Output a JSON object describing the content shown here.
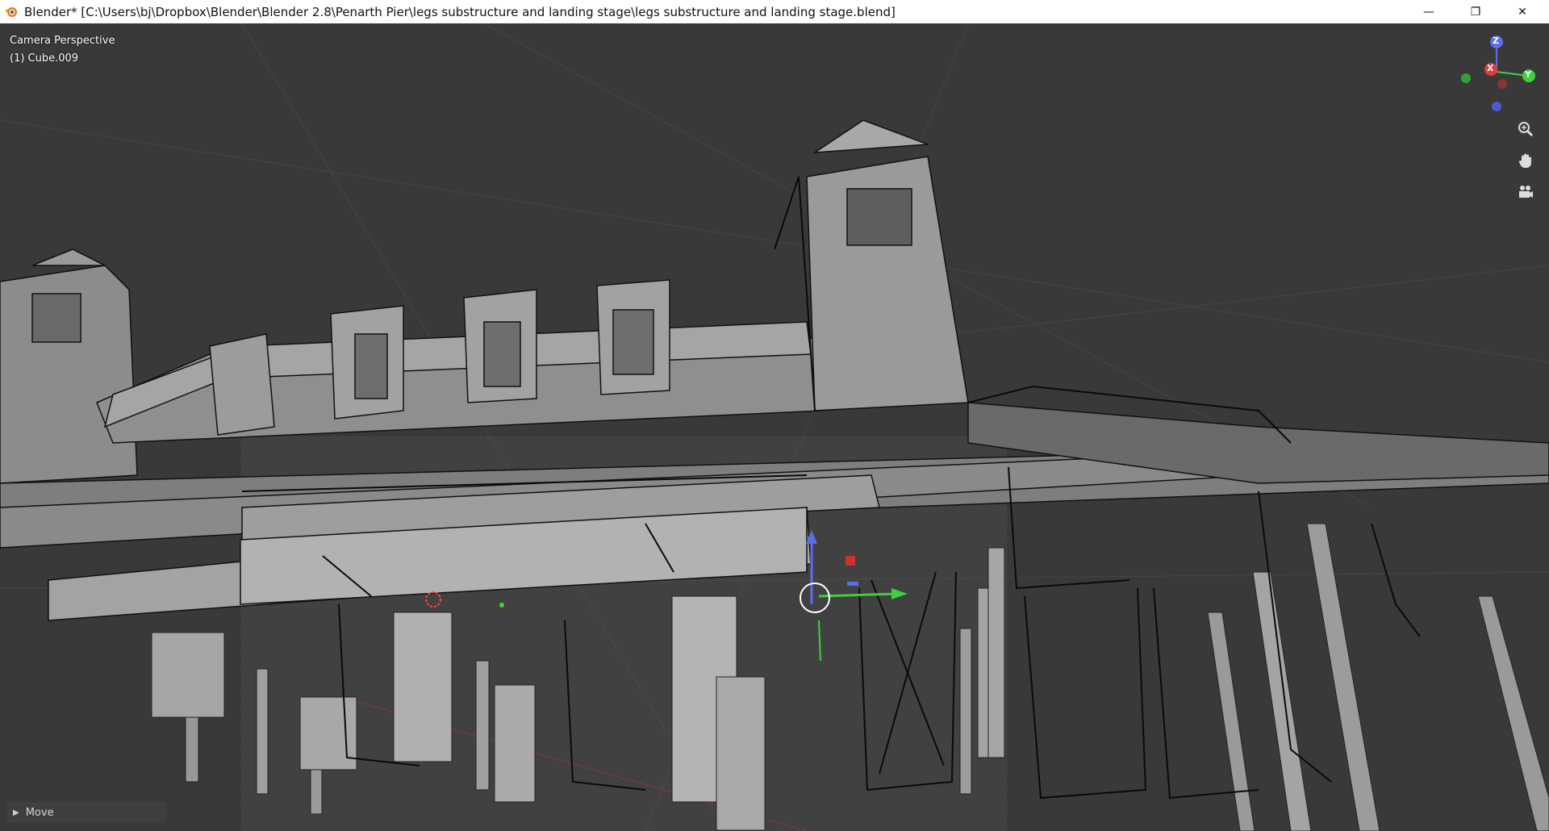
{
  "window": {
    "title": "Blender* [C:\\Users\\bj\\Dropbox\\Blender\\Blender 2.8\\Penarth Pier\\legs substructure and landing stage\\legs substructure and landing stage.blend]",
    "app_icon": "blender-logo-icon",
    "controls": {
      "minimize": "—",
      "restore": "❐",
      "close": "✕"
    }
  },
  "viewport": {
    "view_name": "Camera Perspective",
    "active_object": "(1) Cube.009",
    "gizmo_labels": {
      "x": "X",
      "y": "Y",
      "z": "Z"
    },
    "nav_icons": [
      "zoom-icon",
      "pan-hand-icon",
      "camera-icon"
    ],
    "colors": {
      "x_axis": "#e03a3a",
      "y_axis": "#3fcf3f",
      "z_axis": "#5a6ee8",
      "background": "#393939"
    }
  },
  "operator_panel": {
    "label": "Move"
  }
}
